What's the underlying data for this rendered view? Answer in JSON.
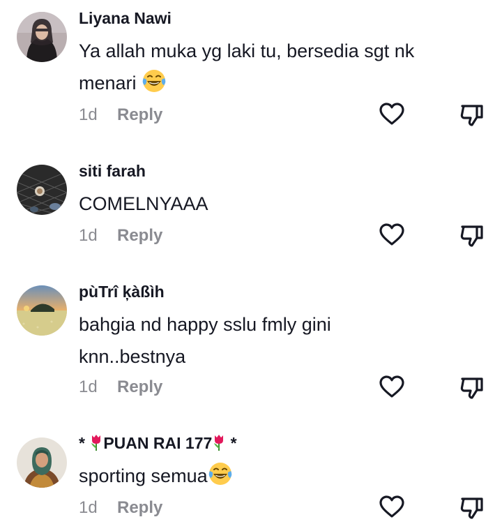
{
  "comments": [
    {
      "username": "Liyana Nawi",
      "text_line1": "Ya allah muka yg laki tu, bersedia sgt nk",
      "text_line2": "menari",
      "time": "1d",
      "reply_label": "Reply"
    },
    {
      "username": "siti farah",
      "text_line1": "COMELNYAAA",
      "time": "1d",
      "reply_label": "Reply"
    },
    {
      "username": "pùTrî ķàßìh",
      "text_line1": "bahgia nd happy sslu fmly gini",
      "text_line2": "knn..bestnya",
      "time": "1d",
      "reply_label": "Reply"
    },
    {
      "username_prefix": "*",
      "username_main": "PUAN RAI 177",
      "username_suffix": "*",
      "text_line1": "sporting semua",
      "time": "1d",
      "reply_label": "Reply"
    }
  ],
  "icons": {
    "like": "heart-outline-icon",
    "dislike": "thumbs-down-outline-icon",
    "emoji": "face-with-tears-of-joy",
    "tulip": "tulip"
  },
  "colors": {
    "text_primary": "#161823",
    "text_secondary": "#8a8b91",
    "icon_stroke": "#161823"
  }
}
